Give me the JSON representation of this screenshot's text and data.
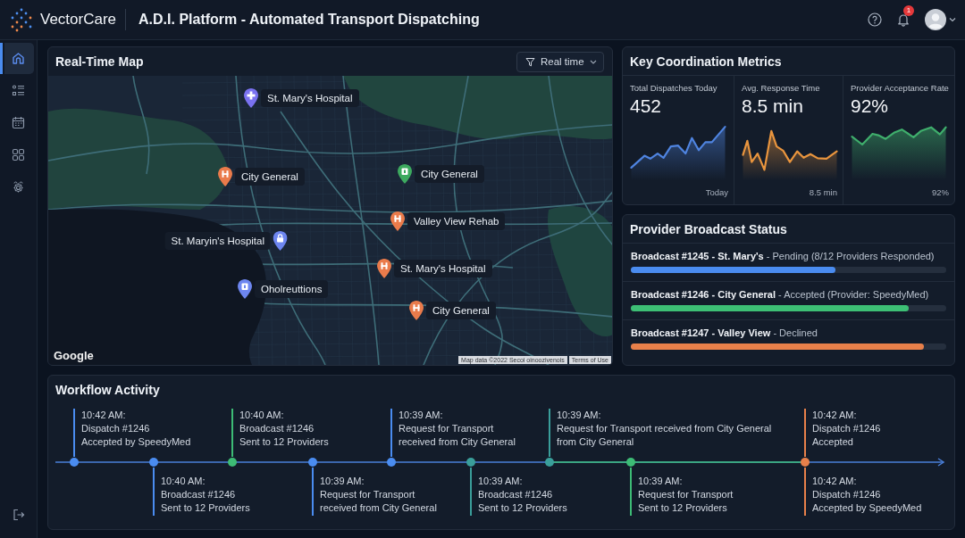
{
  "header": {
    "brand": "VectorCare",
    "title": "A.D.I. Platform - Automated Transport Dispatching",
    "notification_count": "1"
  },
  "sidebar": {
    "items": [
      {
        "selected": true
      },
      {
        "selected": false
      },
      {
        "selected": false
      },
      {
        "selected": false
      },
      {
        "selected": false
      }
    ]
  },
  "map_panel": {
    "title": "Real-Time Map",
    "filter": {
      "value": "Real time"
    },
    "pins": [
      {
        "label": "St. Mary's Hospital",
        "color": "#7a72f0"
      },
      {
        "label": "City General",
        "color": "#ea7b4b"
      },
      {
        "label": "City General",
        "color": "#3daa5f"
      },
      {
        "label": "Valley View Rehab",
        "color": "#ea7b4b"
      },
      {
        "label": "St. Maryin's Hospital",
        "color": "#6d86f0"
      },
      {
        "label": "Oholreuttions",
        "color": "#6d86f0"
      },
      {
        "label": "St. Mary's Hospital",
        "color": "#ea7b4b"
      },
      {
        "label": "City General",
        "color": "#ea7b4b"
      }
    ],
    "attribution": {
      "logo": "Google",
      "map_data": "Map data ©2022 Secoi oinoozivenois",
      "terms": "Terms of Use"
    }
  },
  "metrics_panel": {
    "title": "Key Coordination Metrics",
    "metrics": [
      {
        "label": "Total Dispatches Today",
        "value": "452",
        "footnote": "Today"
      },
      {
        "label": "Avg. Response Time",
        "value": "8.5 min",
        "footnote": "8.5 min"
      },
      {
        "label": "Provider Acceptance Rate",
        "value": "92%",
        "footnote": "92%"
      }
    ]
  },
  "broadcast_panel": {
    "title": "Provider Broadcast Status",
    "broadcasts": [
      {
        "text": "**Broadcast #1245 - St. Mary's** - Pending (8/12 Providers Responded)",
        "level": 0.65,
        "color": "#4a8cf0"
      },
      {
        "text": "**Broadcast #1246 - City General** - Accepted (Provider: SpeedyMed)",
        "level": 0.88,
        "color": "#3dbf75"
      },
      {
        "text": "**Broadcast #1247 - Valley View** - Declined",
        "level": 0.93,
        "color": "#e8804a"
      }
    ]
  },
  "workflow_panel": {
    "title": "Workflow Activity",
    "events": [
      {
        "color": "#4a8cf0",
        "above": {
          "time": "10:42 AM:",
          "lines": [
            "Dispatch #1246",
            "Accepted by SpeedyMed"
          ]
        }
      },
      {
        "color": "#4a8cf0",
        "below": {
          "time": "10:40 AM:",
          "lines": [
            "Broadcast #1246",
            "Sent to 12 Providers"
          ]
        }
      },
      {
        "color": "#3dbb75",
        "above": {
          "time": "10:40 AM:",
          "lines": [
            "Broadcast #1246",
            "Sent to 12 Providers"
          ]
        }
      },
      {
        "color": "#4a8cf0",
        "below": {
          "time": "10:39 AM:",
          "lines": [
            "Request for Transport",
            "received from City General"
          ]
        }
      },
      {
        "color": "#4a8cf0",
        "above": {
          "time": "10:39 AM:",
          "lines": [
            "Request for Transport",
            "received from City General"
          ]
        }
      },
      {
        "color": "#3a9e9a",
        "below": {
          "time": "10:39 AM:",
          "lines": [
            "Broadcast #1246",
            "Sent to 12 Providers"
          ]
        }
      },
      {
        "color": "#3a9e9a",
        "above": {
          "time": "10:39 AM:",
          "lines": [
            "Request for Transport received from City General",
            "from City General"
          ]
        }
      },
      {
        "color": "#3dbb75",
        "below": {
          "time": "10:39 AM:",
          "lines": [
            "Request for Transport",
            "Sent to 12 Providers"
          ]
        }
      },
      {
        "color": "#e8804a",
        "above": {
          "time": "10:42 AM:",
          "lines": [
            "Dispatch #1246",
            "Accepted"
          ]
        },
        "below": {
          "time": "10:42 AM:",
          "lines": [
            "Dispatch #1246",
            "Accepted by SpeedyMed"
          ]
        }
      }
    ]
  }
}
